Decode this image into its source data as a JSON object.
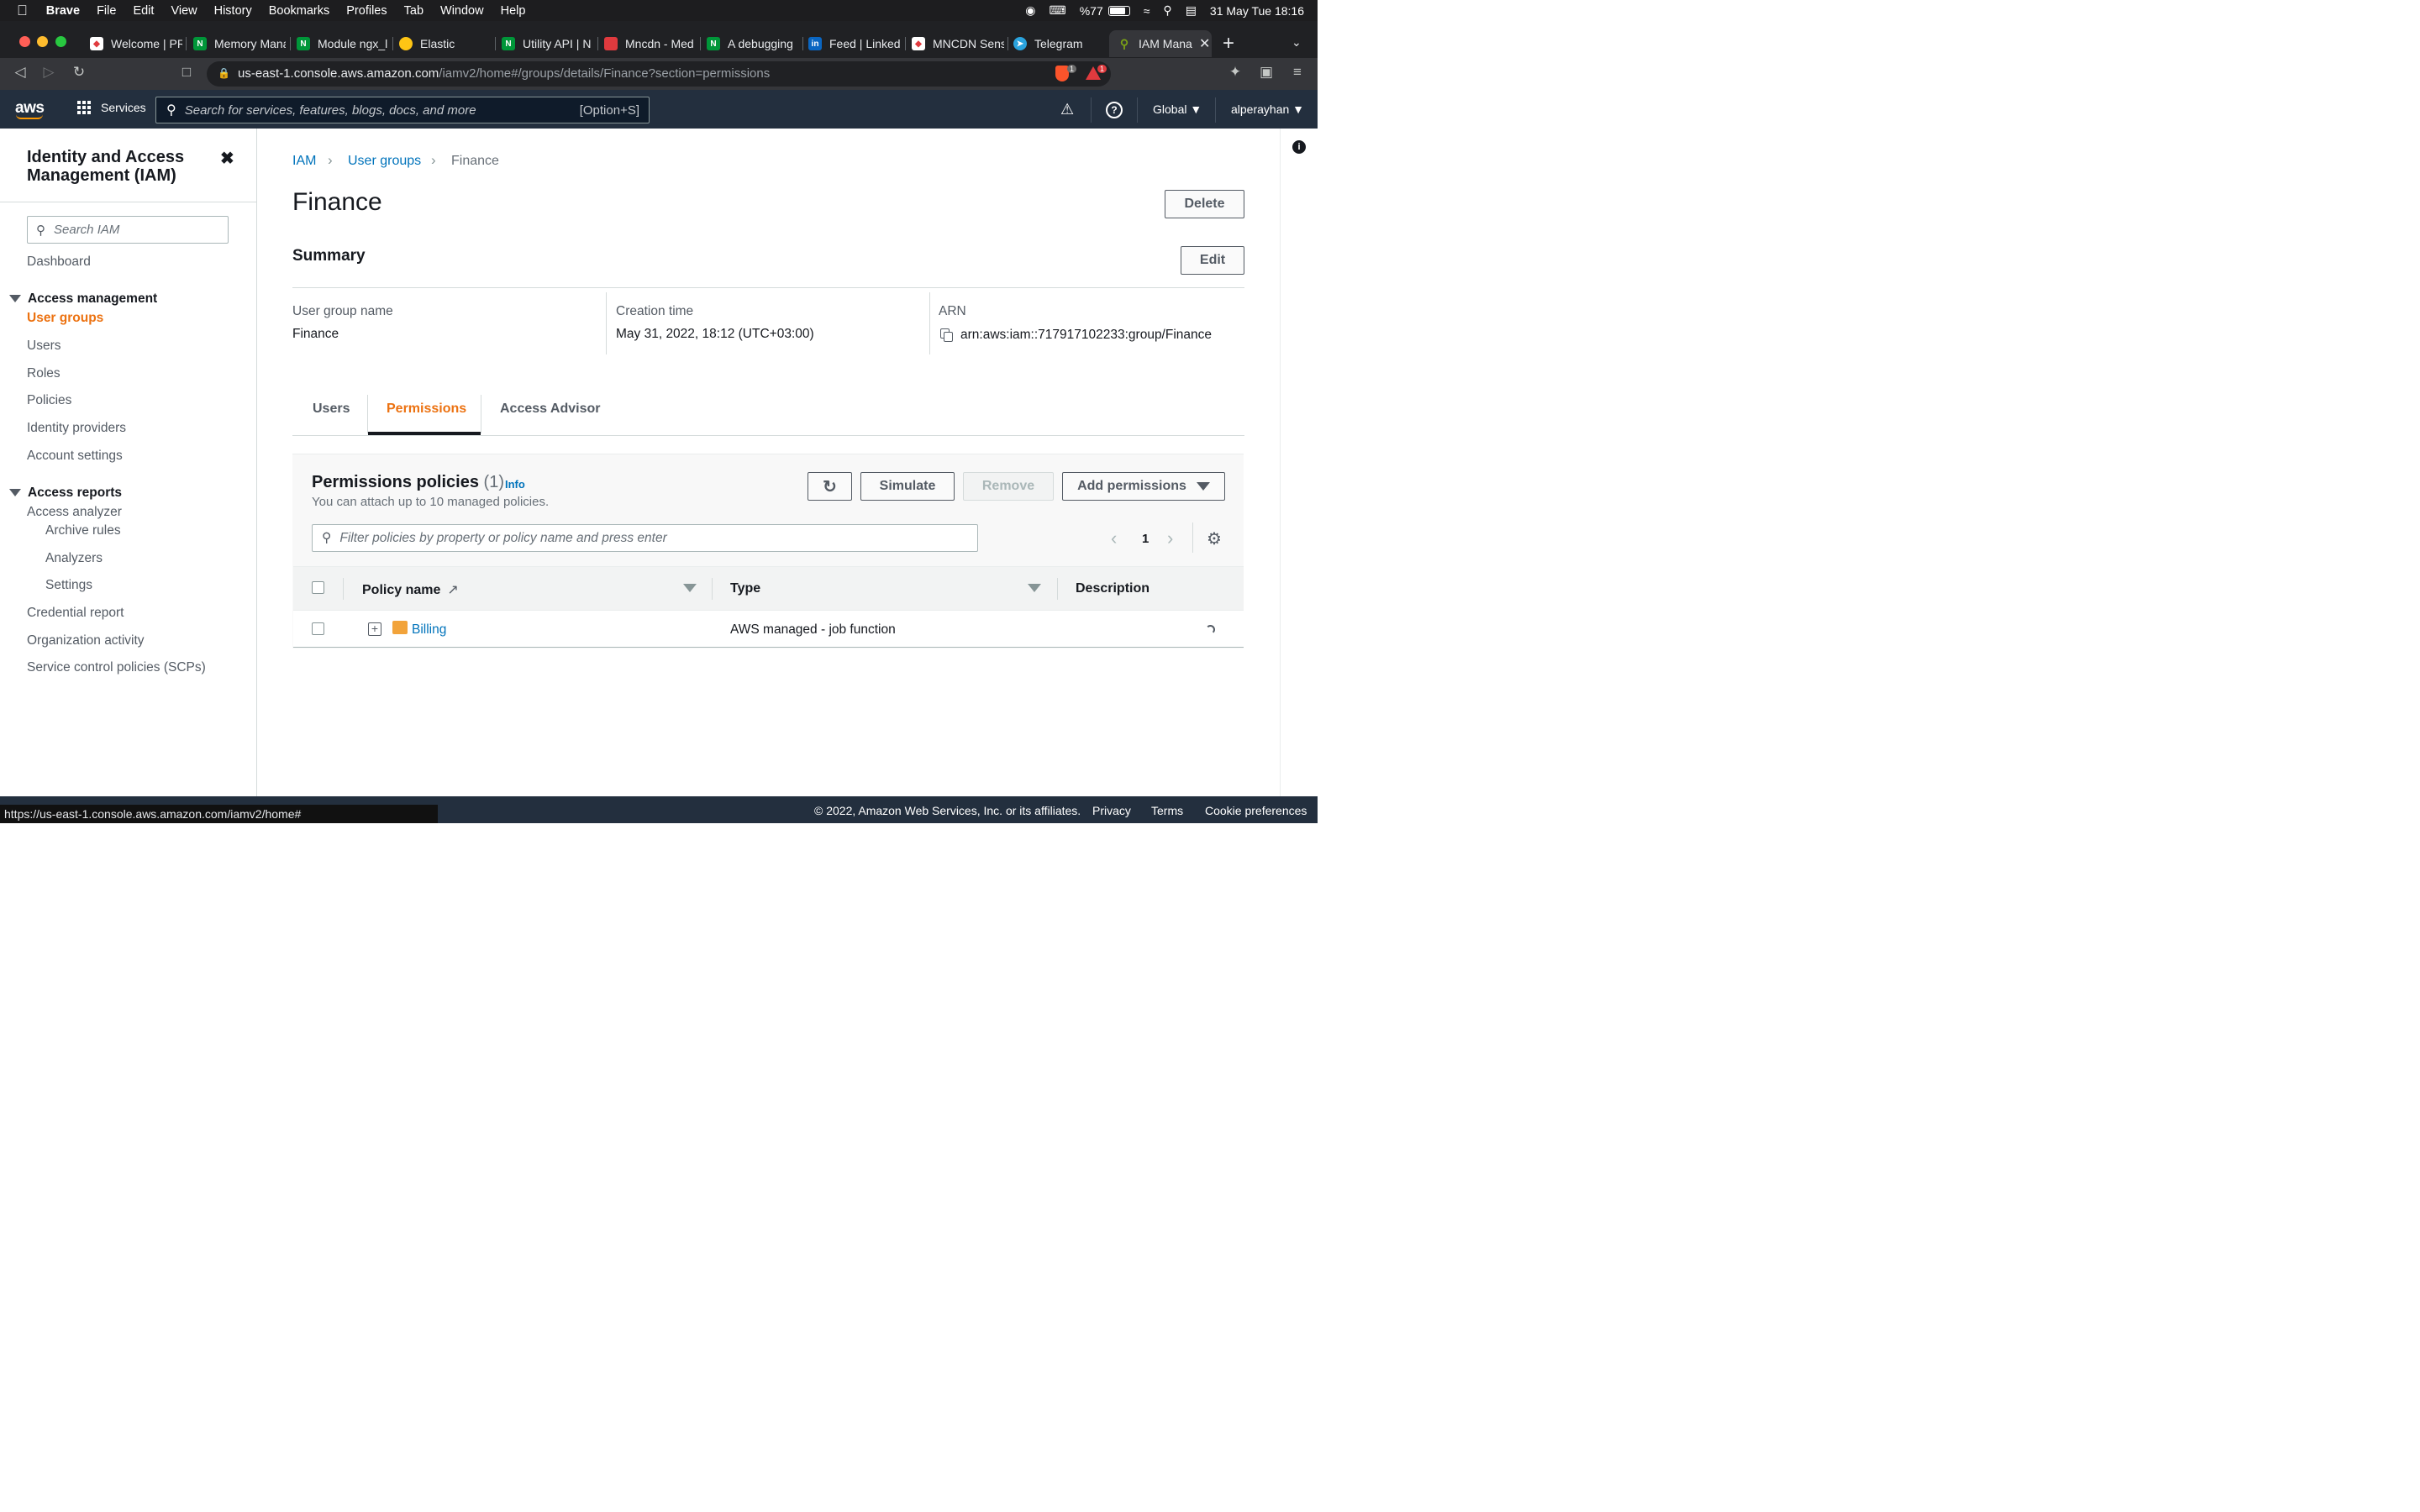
{
  "mac_menu": {
    "app": "Brave",
    "items": [
      "File",
      "Edit",
      "View",
      "History",
      "Bookmarks",
      "Profiles",
      "Tab",
      "Window",
      "Help"
    ],
    "battery": "%77",
    "clock": "31 May Tue  18:16"
  },
  "browser": {
    "tabs": [
      {
        "title": "Welcome | PR",
        "color": "#ffffff",
        "glyph": ""
      },
      {
        "title": "Memory Mana",
        "color": "#009639",
        "glyph": "N"
      },
      {
        "title": "Module ngx_l",
        "color": "#009639",
        "glyph": "N"
      },
      {
        "title": "Elastic",
        "color": "#fec514",
        "glyph": ""
      },
      {
        "title": "Utility API | N",
        "color": "#009639",
        "glyph": "N"
      },
      {
        "title": "Mncdn - Med",
        "color": "#e03a3e",
        "glyph": ""
      },
      {
        "title": "A debugging",
        "color": "#009639",
        "glyph": "N"
      },
      {
        "title": "Feed | Linked",
        "color": "#0a66c2",
        "glyph": "in"
      },
      {
        "title": "MNCDN Sens",
        "color": "#ffffff",
        "glyph": ""
      },
      {
        "title": "Telegram",
        "color": "#2aa3de",
        "glyph": ""
      },
      {
        "title": "IAM Mana",
        "color": "#7aa116",
        "glyph": ""
      }
    ],
    "url_host": "us-east-1.console.aws.amazon.com",
    "url_path": "/iamv2/home#/groups/details/Finance?section=permissions",
    "shield_badge": "1",
    "bat_badge": "1",
    "status_url": "https://us-east-1.console.aws.amazon.com/iamv2/home#"
  },
  "aws_header": {
    "logo": "aws",
    "services": "Services",
    "search_placeholder": "Search for services, features, blogs, docs, and more",
    "search_shortcut": "[Option+S]",
    "region": "Global",
    "user": "alperayhan"
  },
  "sidebar": {
    "title": "Identity and Access Management (IAM)",
    "search_placeholder": "Search IAM",
    "dashboard": "Dashboard",
    "access_management": "Access management",
    "am_items": [
      "User groups",
      "Users",
      "Roles",
      "Policies",
      "Identity providers",
      "Account settings"
    ],
    "access_reports": "Access reports",
    "access_analyzer": "Access analyzer",
    "analyzer_items": [
      "Archive rules",
      "Analyzers",
      "Settings"
    ],
    "report_items": [
      "Credential report",
      "Organization activity",
      "Service control policies (SCPs)"
    ]
  },
  "breadcrumb": {
    "iam": "IAM",
    "user_groups": "User groups",
    "current": "Finance"
  },
  "page": {
    "title": "Finance",
    "delete": "Delete",
    "summary": "Summary",
    "edit": "Edit",
    "group_name_label": "User group name",
    "group_name": "Finance",
    "creation_label": "Creation time",
    "creation_time": "May 31, 2022, 18:12 (UTC+03:00)",
    "arn_label": "ARN",
    "arn": "arn:aws:iam::717917102233:group/Finance"
  },
  "tabs": {
    "users": "Users",
    "permissions": "Permissions",
    "access_advisor": "Access Advisor"
  },
  "permissions": {
    "heading": "Permissions policies",
    "count": "(1)",
    "info": "Info",
    "subtitle": "You can attach up to 10 managed policies.",
    "simulate": "Simulate",
    "remove": "Remove",
    "add_permissions": "Add permissions",
    "filter_placeholder": "Filter policies by property or policy name and press enter",
    "page": "1",
    "columns": {
      "policy_name": "Policy name",
      "type": "Type",
      "description": "Description"
    },
    "rows": [
      {
        "name": "Billing",
        "type": "AWS managed - job function"
      }
    ]
  },
  "footer": {
    "copyright": "© 2022, Amazon Web Services, Inc. or its affiliates.",
    "privacy": "Privacy",
    "terms": "Terms",
    "cookies": "Cookie preferences"
  }
}
